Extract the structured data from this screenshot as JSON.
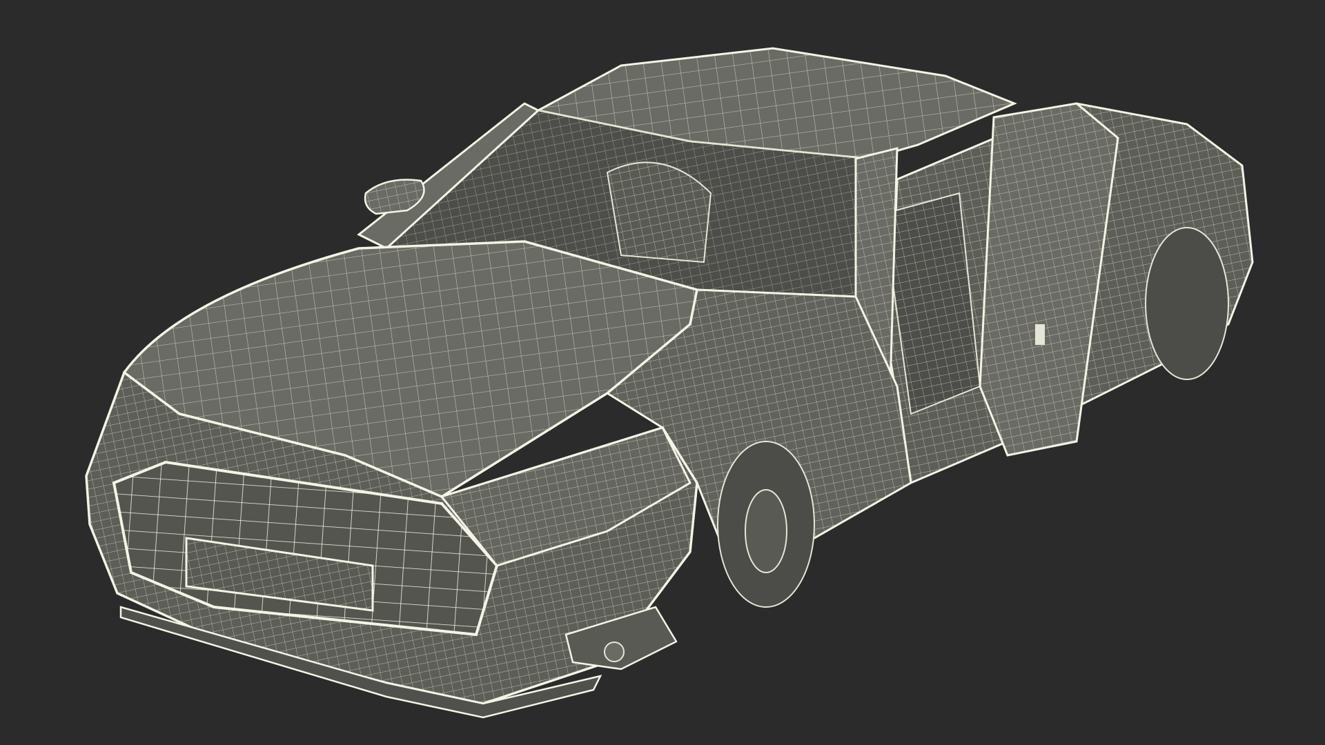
{
  "scene": {
    "subject": "car-body-wireframe",
    "background_color": "#2b2b2b",
    "surface_color": "#6b6b65",
    "surface_dark_color": "#575752",
    "wire_color": "#e6e6d6",
    "wire_bright_color": "#f4f4e6"
  }
}
